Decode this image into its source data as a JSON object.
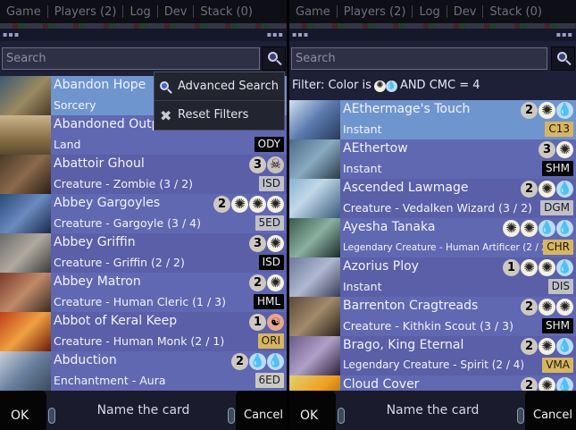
{
  "left": {
    "tabs": [
      "Game",
      "Players (2)",
      "Log",
      "Dev",
      "Stack (0)"
    ],
    "search": {
      "placeholder": "Search"
    },
    "dropdown": {
      "advanced_search": "Advanced Search",
      "reset_filters": "Reset Filters"
    },
    "cards": [
      {
        "name": "Abandon Hope",
        "type": "Sorcery",
        "set": "",
        "set_style": "",
        "cost": []
      },
      {
        "name": "Abandoned Outpost",
        "type": "Land",
        "set": "ODY",
        "set_style": "black",
        "cost": []
      },
      {
        "name": "Abattoir Ghoul",
        "type": "Creature - Zombie (3 / 2)",
        "set": "ISD",
        "set_style": "silver",
        "cost": [
          "3",
          "B"
        ]
      },
      {
        "name": "Abbey Gargoyles",
        "type": "Creature - Gargoyle (3 / 4)",
        "set": "5ED",
        "set_style": "silver",
        "cost": [
          "2",
          "W",
          "W",
          "W"
        ]
      },
      {
        "name": "Abbey Griffin",
        "type": "Creature - Griffin (2 / 2)",
        "set": "ISD",
        "set_style": "black",
        "cost": [
          "3",
          "W"
        ]
      },
      {
        "name": "Abbey Matron",
        "type": "Creature - Human Cleric (1 / 3)",
        "set": "HML",
        "set_style": "black",
        "cost": [
          "2",
          "W"
        ]
      },
      {
        "name": "Abbot of Keral Keep",
        "type": "Creature - Human Monk (2 / 1)",
        "set": "ORI",
        "set_style": "gold",
        "cost": [
          "1",
          "R"
        ]
      },
      {
        "name": "Abduction",
        "type": "Enchantment - Aura",
        "set": "6ED",
        "set_style": "grey",
        "cost": [
          "2",
          "U",
          "U"
        ]
      }
    ],
    "bottom": {
      "ok": "OK",
      "title": "Name the card",
      "cancel": "Cancel"
    }
  },
  "right": {
    "tabs": [
      "Game",
      "Players (2)",
      "Log",
      "Dev",
      "Stack (0)"
    ],
    "search": {
      "placeholder": "Search"
    },
    "filter": {
      "prefix": "Filter: Color is",
      "suffix": "AND CMC = 4"
    },
    "cards": [
      {
        "name": "AEthermage's Touch",
        "type": "Instant",
        "set": "C13",
        "set_style": "gold",
        "cost": [
          "2",
          "W",
          "U"
        ]
      },
      {
        "name": "AEthertow",
        "type": "Instant",
        "set": "SHM",
        "set_style": "black",
        "cost": [
          "3",
          "W"
        ]
      },
      {
        "name": "Ascended Lawmage",
        "type": "Creature - Vedalken Wizard (3 / 2)",
        "set": "DGM",
        "set_style": "silver",
        "cost": [
          "2",
          "W",
          "U"
        ]
      },
      {
        "name": "Ayesha Tanaka",
        "type": "Legendary Creature - Human Artificer (2 / 2)",
        "set": "CHR",
        "set_style": "gold",
        "cost": [
          "W",
          "W",
          "U",
          "U"
        ]
      },
      {
        "name": "Azorius Ploy",
        "type": "Instant",
        "set": "DIS",
        "set_style": "silver",
        "cost": [
          "1",
          "W",
          "W",
          "U"
        ]
      },
      {
        "name": "Barrenton Cragtreads",
        "type": "Creature - Kithkin Scout (3 / 3)",
        "set": "SHM",
        "set_style": "black",
        "cost": [
          "2",
          "W",
          "W"
        ]
      },
      {
        "name": "Brago, King Eternal",
        "type": "Legendary Creature - Spirit (2 / 4)",
        "set": "VMA",
        "set_style": "gold",
        "cost": [
          "2",
          "W",
          "U"
        ]
      },
      {
        "name": "Cloud Cover",
        "type": "",
        "set": "",
        "set_style": "",
        "cost": [
          "2",
          "W",
          "U"
        ]
      }
    ],
    "bottom": {
      "ok": "OK",
      "title": "Name the card",
      "cancel": "Cancel"
    }
  }
}
